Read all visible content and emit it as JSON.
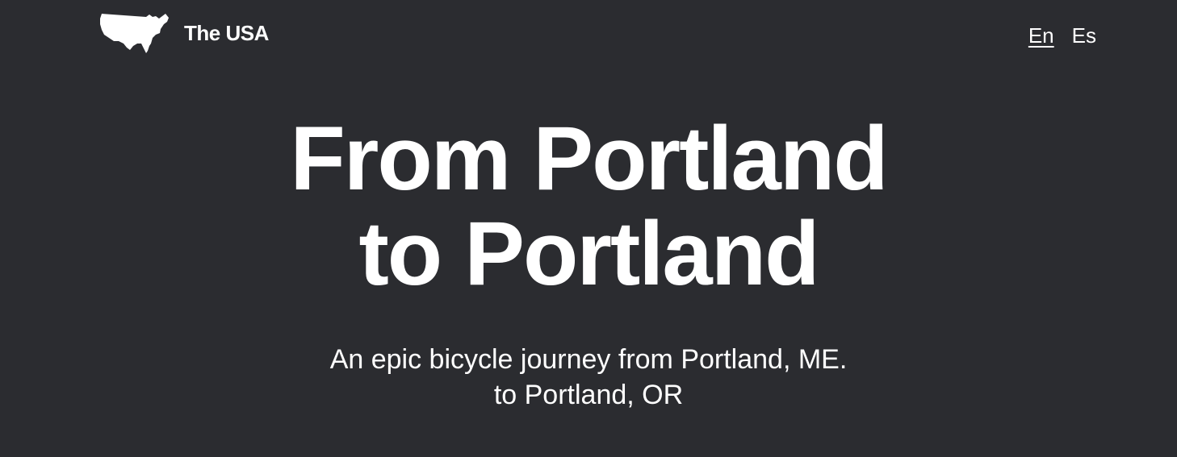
{
  "header": {
    "brand_name": "The USA",
    "logo_icon": "usa-map-icon",
    "languages": [
      {
        "code": "En",
        "active": true
      },
      {
        "code": "Es",
        "active": false
      }
    ]
  },
  "hero": {
    "title_line_1": "From Portland",
    "title_line_2": "to Portland",
    "subtitle_line_1": "An epic bicycle journey from Portland, ME.",
    "subtitle_line_2": "to Portland, OR"
  },
  "colors": {
    "background": "#2b2c30",
    "text": "#ffffff"
  }
}
